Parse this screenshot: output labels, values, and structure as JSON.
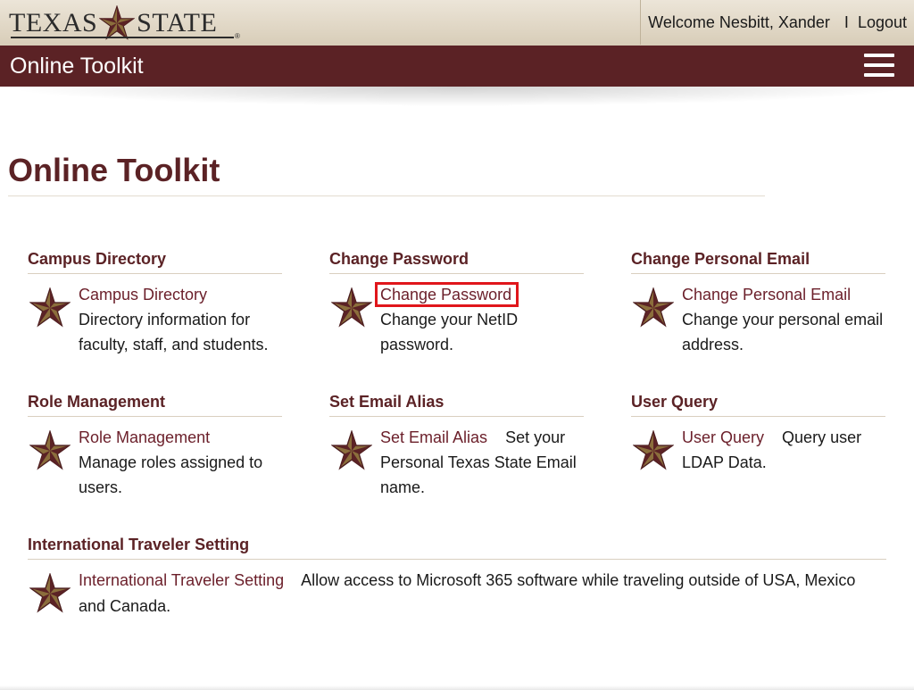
{
  "header": {
    "logo_left": "TEXAS",
    "logo_right": "STATE",
    "logo_reg": "®",
    "welcome": "Welcome Nesbitt, Xander",
    "separator": "I",
    "logout": "Logout"
  },
  "nav": {
    "title": "Online Toolkit",
    "menu_icon": "hamburger-menu-icon"
  },
  "page": {
    "title": "Online Toolkit"
  },
  "cards": [
    {
      "heading": "Campus Directory",
      "link": "Campus Directory",
      "description": "Directory information for faculty, staff, and students."
    },
    {
      "heading": "Change Password",
      "link": "Change Password",
      "description": "Change your NetID password."
    },
    {
      "heading": "Change Personal Email",
      "link": "Change Personal Email",
      "description": "Change your personal email address."
    },
    {
      "heading": "Role Management",
      "link": "Role Management",
      "description": "Manage roles assigned to users."
    },
    {
      "heading": "Set Email Alias",
      "link": "Set Email Alias",
      "description": "Set your Personal Texas State Email name."
    },
    {
      "heading": "User Query",
      "link": "User Query",
      "description": "Query user LDAP Data."
    },
    {
      "heading": "International Traveler Setting",
      "link": "International Traveler Setting",
      "description": "Allow access to Microsoft 365 software while traveling outside of USA, Mexico and Canada."
    }
  ],
  "colors": {
    "maroon": "#5b2225",
    "link": "#6b1f2a",
    "gold": "#8b6e3c",
    "highlight": "#e0161b"
  },
  "icons": {
    "card_icon": "star-icon"
  }
}
